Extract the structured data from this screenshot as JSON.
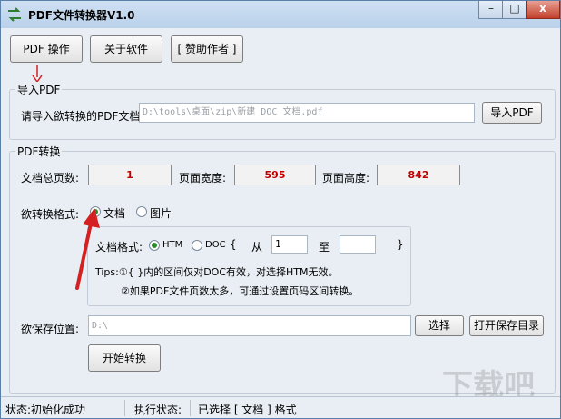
{
  "window": {
    "title": "PDF文件转换器V1.0",
    "title_buttons": [
      "–",
      "□",
      "x"
    ]
  },
  "toolbar": {
    "pdf_ops": "PDF 操作",
    "about": "关于软件",
    "sponsor": "[ 赞助作者 ]"
  },
  "import_group": {
    "title": "导入PDF",
    "prompt": "请导入欲转换的PDF文档:",
    "path": "D:\\tools\\桌面\\zip\\新建 DOC 文档.pdf",
    "button": "导入PDF"
  },
  "convert_group": {
    "title": "PDF转换",
    "total_pages_label": "文档总页数:",
    "total_pages": "1",
    "page_width_label": "页面宽度:",
    "page_width": "595",
    "page_height_label": "页面高度:",
    "page_height": "842",
    "format_label": "欲转换格式:",
    "format_options": [
      {
        "label": "文档",
        "selected": true
      },
      {
        "label": "图片",
        "selected": false
      }
    ],
    "doc_format_label": "文档格式:",
    "doc_options": [
      {
        "label": "HTM",
        "selected": true
      },
      {
        "label": "DOC",
        "selected": false
      }
    ],
    "bracket_open": "{",
    "from_label": "从",
    "from_value": "1",
    "to_label": "至",
    "to_value": "",
    "bracket_close": "}",
    "tips_1": "Tips:①{ }内的区间仅对DOC有效，对选择HTM无效。",
    "tips_2": "②如果PDF文件页数太多，可通过设置页码区间转换。"
  },
  "save": {
    "label": "欲保存位置:",
    "path": "D:\\",
    "choose_button": "选择",
    "open_button": "打开保存目录"
  },
  "start_button": "开始转换",
  "statusbar": {
    "status": "状态:初始化成功",
    "exec_label": "执行状态:",
    "exec_value": "已选择 [ 文档 ] 格式"
  },
  "watermark": "下载吧",
  "colors": {
    "value_text": "#c00000",
    "arrow": "#d42020",
    "radio_dot": "#2a8c2a"
  }
}
